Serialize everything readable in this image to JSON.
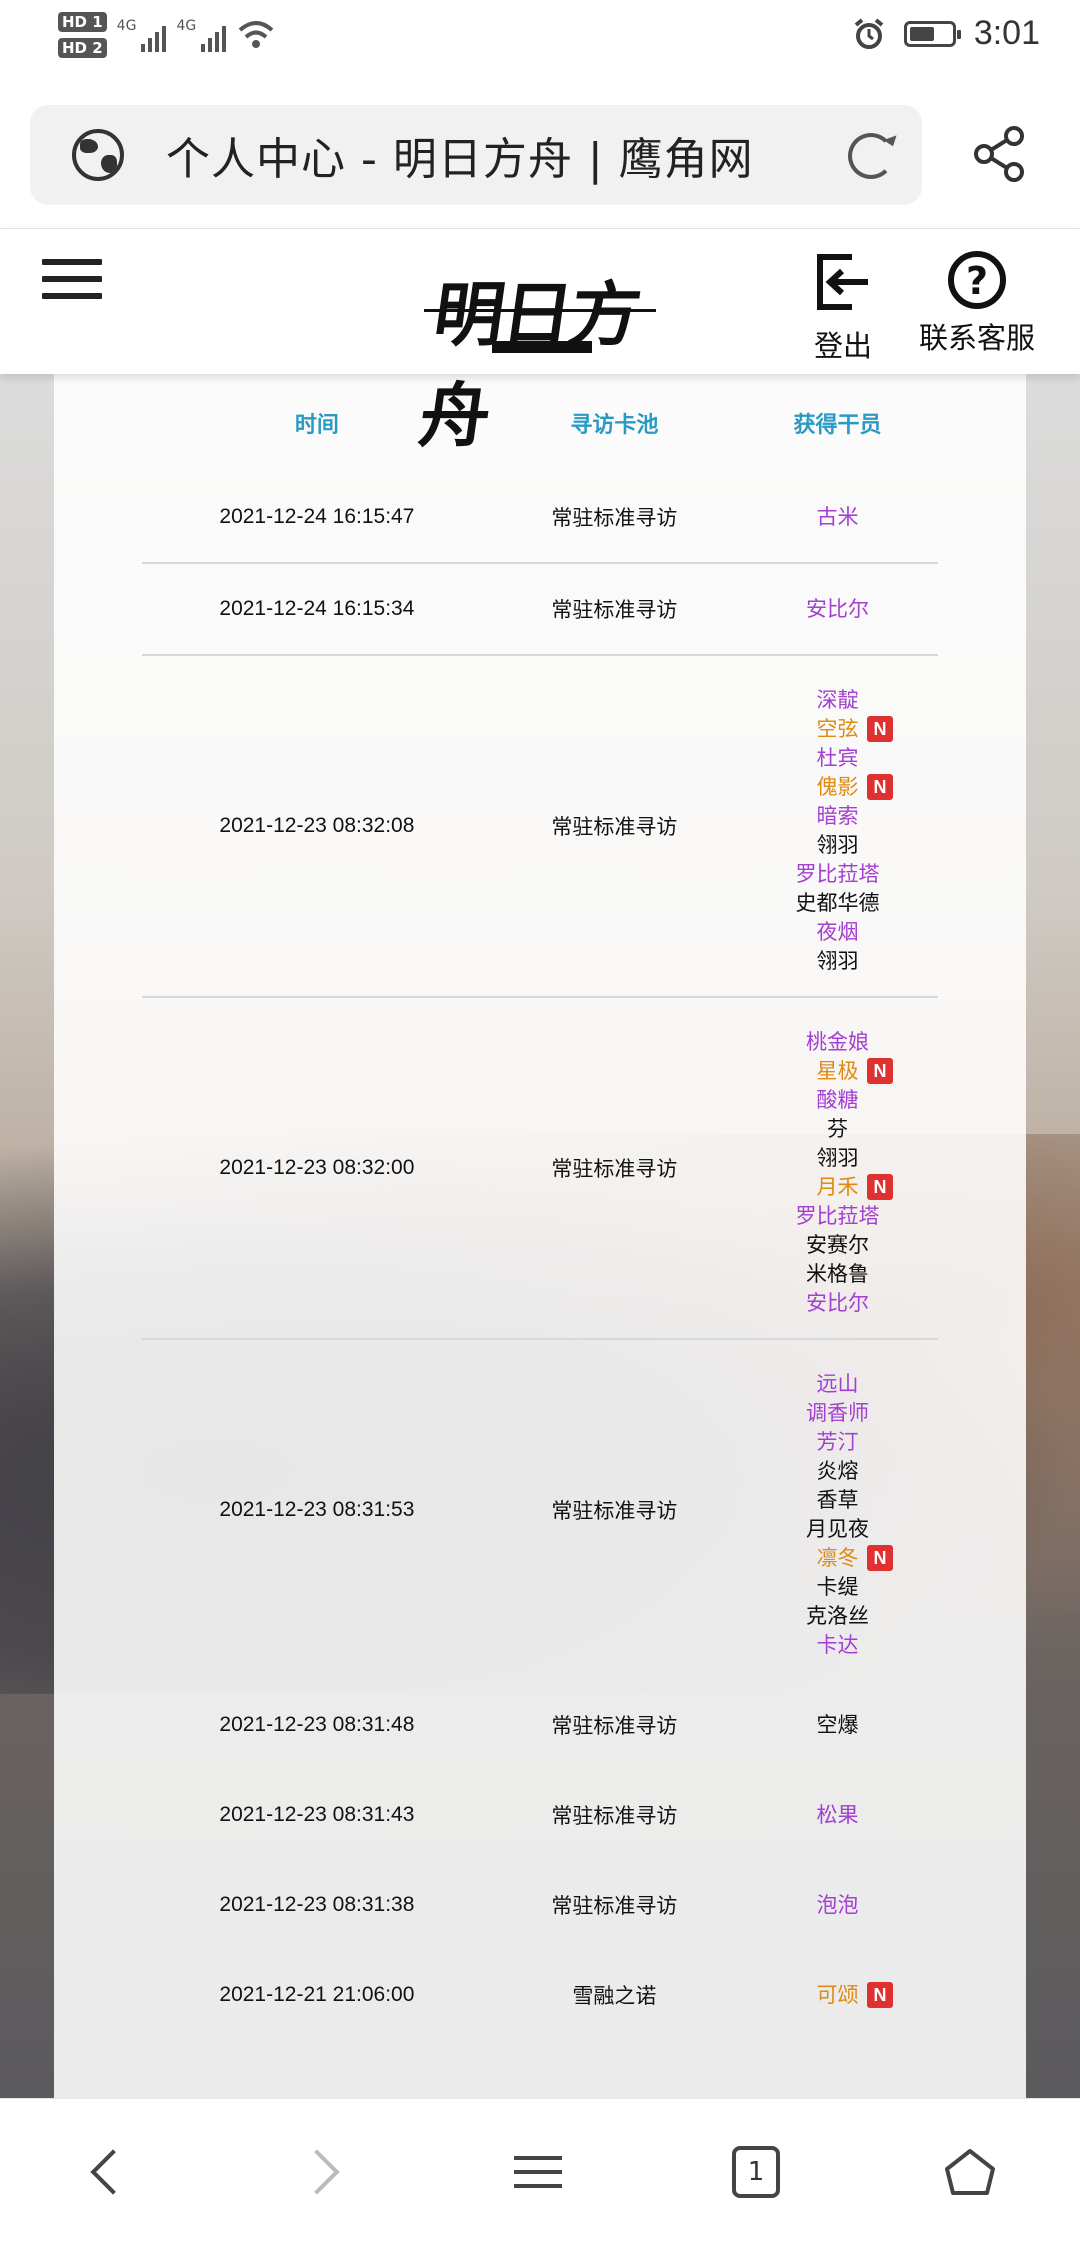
{
  "status_bar": {
    "sim1": "HD 1",
    "sim2": "HD 2",
    "net1": "4G",
    "net2": "4G",
    "time": "3:01",
    "battery_percent": 60
  },
  "url_bar": {
    "title": "个人中心 - 明日方舟 | 鹰角网"
  },
  "header": {
    "logo": "明日方舟",
    "logout_label": "登出",
    "support_label": "联系客服",
    "help_glyph": "?"
  },
  "table": {
    "headers": [
      "时间",
      "寻访卡池",
      "获得干员"
    ],
    "new_badge": "N",
    "rows": [
      {
        "time": "2021-12-24 16:15:47",
        "pool": "常驻标准寻访",
        "ops": [
          {
            "name": "古米",
            "rarity": "purple",
            "new": false
          }
        ]
      },
      {
        "time": "2021-12-24 16:15:34",
        "pool": "常驻标准寻访",
        "ops": [
          {
            "name": "安比尔",
            "rarity": "purple",
            "new": false
          }
        ]
      },
      {
        "time": "2021-12-23 08:32:08",
        "pool": "常驻标准寻访",
        "ops": [
          {
            "name": "深靛",
            "rarity": "purple",
            "new": false
          },
          {
            "name": "空弦",
            "rarity": "gold",
            "new": true
          },
          {
            "name": "杜宾",
            "rarity": "purple",
            "new": false
          },
          {
            "name": "傀影",
            "rarity": "gold",
            "new": true
          },
          {
            "name": "暗索",
            "rarity": "purple",
            "new": false
          },
          {
            "name": "翎羽",
            "rarity": "black",
            "new": false
          },
          {
            "name": "罗比菈塔",
            "rarity": "purple",
            "new": false
          },
          {
            "name": "史都华德",
            "rarity": "black",
            "new": false
          },
          {
            "name": "夜烟",
            "rarity": "purple",
            "new": false
          },
          {
            "name": "翎羽",
            "rarity": "black",
            "new": false
          }
        ]
      },
      {
        "time": "2021-12-23 08:32:00",
        "pool": "常驻标准寻访",
        "ops": [
          {
            "name": "桃金娘",
            "rarity": "purple",
            "new": false
          },
          {
            "name": "星极",
            "rarity": "gold",
            "new": true
          },
          {
            "name": "酸糖",
            "rarity": "purple",
            "new": false
          },
          {
            "name": "芬",
            "rarity": "black",
            "new": false
          },
          {
            "name": "翎羽",
            "rarity": "black",
            "new": false
          },
          {
            "name": "月禾",
            "rarity": "gold",
            "new": true
          },
          {
            "name": "罗比菈塔",
            "rarity": "purple",
            "new": false
          },
          {
            "name": "安赛尔",
            "rarity": "black",
            "new": false
          },
          {
            "name": "米格鲁",
            "rarity": "black",
            "new": false
          },
          {
            "name": "安比尔",
            "rarity": "purple",
            "new": false
          }
        ]
      },
      {
        "time": "2021-12-23 08:31:53",
        "pool": "常驻标准寻访",
        "ops": [
          {
            "name": "远山",
            "rarity": "purple",
            "new": false
          },
          {
            "name": "调香师",
            "rarity": "purple",
            "new": false
          },
          {
            "name": "芳汀",
            "rarity": "purple",
            "new": false
          },
          {
            "name": "炎熔",
            "rarity": "black",
            "new": false
          },
          {
            "name": "香草",
            "rarity": "black",
            "new": false
          },
          {
            "name": "月见夜",
            "rarity": "black",
            "new": false
          },
          {
            "name": "凛冬",
            "rarity": "gold",
            "new": true
          },
          {
            "name": "卡缇",
            "rarity": "black",
            "new": false
          },
          {
            "name": "克洛丝",
            "rarity": "black",
            "new": false
          },
          {
            "name": "卡达",
            "rarity": "purple",
            "new": false
          }
        ]
      },
      {
        "time": "2021-12-23 08:31:48",
        "pool": "常驻标准寻访",
        "ops": [
          {
            "name": "空爆",
            "rarity": "black",
            "new": false
          }
        ]
      },
      {
        "time": "2021-12-23 08:31:43",
        "pool": "常驻标准寻访",
        "ops": [
          {
            "name": "松果",
            "rarity": "purple",
            "new": false
          }
        ]
      },
      {
        "time": "2021-12-23 08:31:38",
        "pool": "常驻标准寻访",
        "ops": [
          {
            "name": "泡泡",
            "rarity": "purple",
            "new": false
          }
        ]
      },
      {
        "time": "2021-12-21 21:06:00",
        "pool": "雪融之诺",
        "ops": [
          {
            "name": "可颂",
            "rarity": "gold",
            "new": true
          }
        ]
      }
    ]
  },
  "bottom_nav": {
    "tab_count": "1"
  },
  "colors": {
    "header_text": "#2a9ac4",
    "rarity_purple": "#a33fd1",
    "rarity_gold": "#e08a12",
    "badge_red": "#e03131"
  }
}
